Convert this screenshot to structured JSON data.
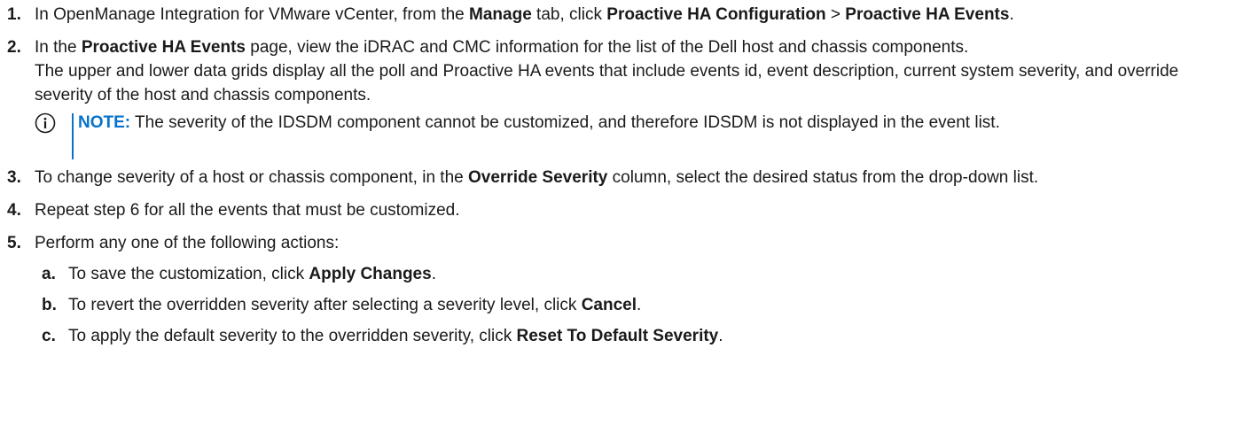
{
  "steps": [
    {
      "number": "1.",
      "parts": [
        {
          "text": "In OpenManage Integration for VMware vCenter, from the ",
          "bold": false
        },
        {
          "text": "Manage",
          "bold": true
        },
        {
          "text": " tab, click ",
          "bold": false
        },
        {
          "text": "Proactive HA Configuration",
          "bold": true
        },
        {
          "text": " > ",
          "bold": false
        },
        {
          "text": "Proactive HA Events",
          "bold": true
        },
        {
          "text": ".",
          "bold": false
        }
      ]
    },
    {
      "number": "2.",
      "parts": [
        {
          "text": "In the ",
          "bold": false
        },
        {
          "text": "Proactive HA Events",
          "bold": true
        },
        {
          "text": " page, view the iDRAC and CMC information for the list of the Dell host and chassis components.",
          "bold": false
        }
      ],
      "body": "The upper and lower data grids display all the poll and Proactive HA events that include events id, event description, current system severity, and override severity of the host and chassis components.",
      "note": {
        "label": "NOTE:",
        "text": " The severity of the IDSDM component cannot be customized, and therefore IDSDM is not displayed in the event list.",
        "icon": "info-icon"
      }
    },
    {
      "number": "3.",
      "parts": [
        {
          "text": "To change severity of a host or chassis component, in the ",
          "bold": false
        },
        {
          "text": "Override Severity",
          "bold": true
        },
        {
          "text": " column, select the desired status from the drop-down list.",
          "bold": false
        }
      ]
    },
    {
      "number": "4.",
      "parts": [
        {
          "text": "Repeat step 6 for all the events that must be customized.",
          "bold": false
        }
      ]
    },
    {
      "number": "5.",
      "parts": [
        {
          "text": "Perform any one of the following actions:",
          "bold": false
        }
      ],
      "substeps": [
        {
          "letter": "a.",
          "parts": [
            {
              "text": "To save the customization, click ",
              "bold": false
            },
            {
              "text": "Apply Changes",
              "bold": true
            },
            {
              "text": ".",
              "bold": false
            }
          ]
        },
        {
          "letter": "b.",
          "parts": [
            {
              "text": "To revert the overridden severity after selecting a severity level, click ",
              "bold": false
            },
            {
              "text": "Cancel",
              "bold": true
            },
            {
              "text": ".",
              "bold": false
            }
          ]
        },
        {
          "letter": "c.",
          "parts": [
            {
              "text": "To apply the default severity to the overridden severity, click ",
              "bold": false
            },
            {
              "text": "Reset To Default Severity",
              "bold": true
            },
            {
              "text": ".",
              "bold": false
            }
          ]
        }
      ]
    }
  ],
  "colors": {
    "text": "#1a1a1a",
    "accent": "#0672CB"
  }
}
